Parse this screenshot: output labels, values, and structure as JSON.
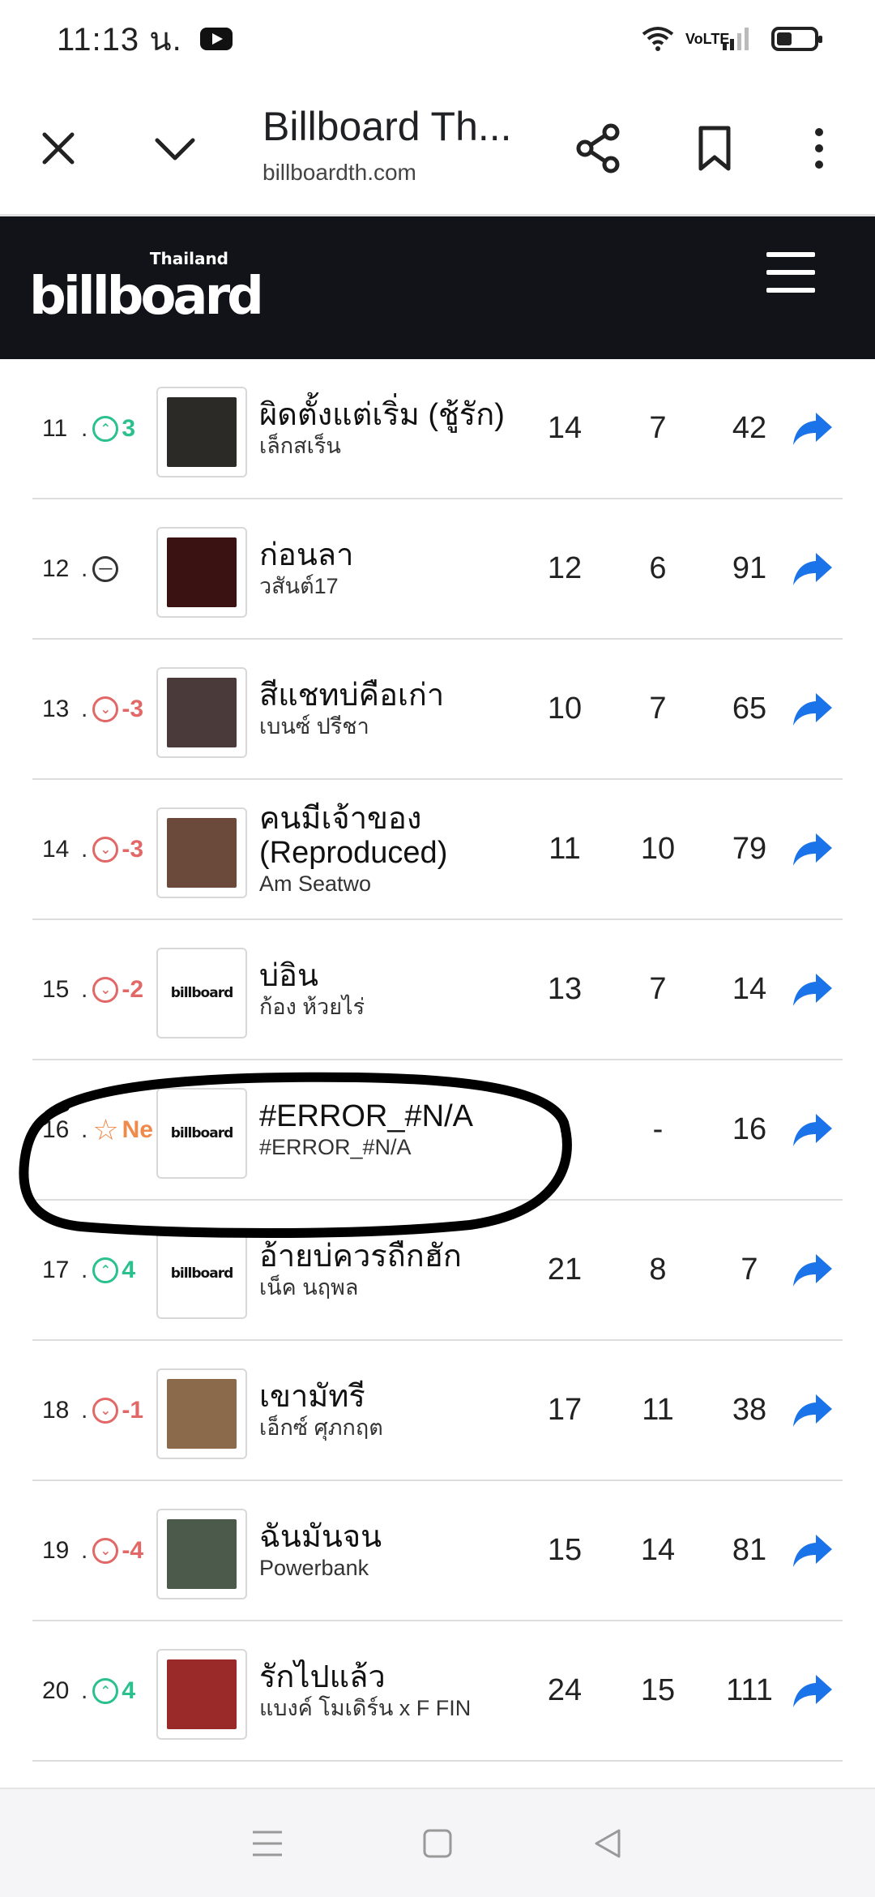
{
  "status_bar": {
    "time": "11:13 น.",
    "network": "VoLTE"
  },
  "browser": {
    "title": "Billboard Th...",
    "url": "billboardth.com"
  },
  "header": {
    "logo_main": "billboard",
    "logo_sub": "Thailand"
  },
  "chart": {
    "rows": [
      {
        "rank": "11",
        "trend": "up",
        "change": "3",
        "title": "ผิดตั้งแต่เริ่ม (ชู้รัก)",
        "artist": "เล็กสเร็น",
        "last_week": "14",
        "peak": "7",
        "weeks": "42",
        "cover": "photo",
        "cover_color": "#2b2a26"
      },
      {
        "rank": "12",
        "trend": "same",
        "change": "",
        "title": "ก่อนลา",
        "artist": "วสันต์17",
        "last_week": "12",
        "peak": "6",
        "weeks": "91",
        "cover": "photo",
        "cover_color": "#3a1212"
      },
      {
        "rank": "13",
        "trend": "down",
        "change": "-3",
        "title": "สีแชทบ่คือเก่า",
        "artist": "เบนซ์ ปรีชา",
        "last_week": "10",
        "peak": "7",
        "weeks": "65",
        "cover": "photo",
        "cover_color": "#4a3b3a"
      },
      {
        "rank": "14",
        "trend": "down",
        "change": "-3",
        "title": "คนมีเจ้าของ (Reproduced)",
        "artist": "Am Seatwo",
        "last_week": "11",
        "peak": "10",
        "weeks": "79",
        "cover": "photo",
        "cover_color": "#6b4a3b"
      },
      {
        "rank": "15",
        "trend": "down",
        "change": "-2",
        "title": "บ่อิน",
        "artist": "ก้อง ห้วยไร่",
        "last_week": "13",
        "peak": "7",
        "weeks": "14",
        "cover": "billboard",
        "cover_color": "#ffffff"
      },
      {
        "rank": "16",
        "trend": "new",
        "change": "Ne",
        "title": "#ERROR_#N/A",
        "artist": "#ERROR_#N/A",
        "last_week": "-",
        "peak": "-",
        "weeks": "16",
        "cover": "billboard",
        "cover_color": "#ffffff"
      },
      {
        "rank": "17",
        "trend": "up",
        "change": "4",
        "title": "อ้ายบ่ควรถืกฮัก",
        "artist": "เน็ค นฤพล",
        "last_week": "21",
        "peak": "8",
        "weeks": "7",
        "cover": "billboard",
        "cover_color": "#ffffff"
      },
      {
        "rank": "18",
        "trend": "down",
        "change": "-1",
        "title": "เขามัทรี",
        "artist": "เอ็กซ์ ศุภกฤต",
        "last_week": "17",
        "peak": "11",
        "weeks": "38",
        "cover": "photo",
        "cover_color": "#8a6a4b"
      },
      {
        "rank": "19",
        "trend": "down",
        "change": "-4",
        "title": "ฉันมันจน",
        "artist": "Powerbank",
        "last_week": "15",
        "peak": "14",
        "weeks": "81",
        "cover": "photo",
        "cover_color": "#4b5a4a"
      },
      {
        "rank": "20",
        "trend": "up",
        "change": "4",
        "title": "รักไปแล้ว",
        "artist": "แบงค์ โมเดิร์น x F FIN",
        "last_week": "24",
        "peak": "15",
        "weeks": "111",
        "cover": "photo",
        "cover_color": "#9a2a2a"
      }
    ]
  },
  "colors": {
    "up": "#2bc08f",
    "down": "#e26868",
    "new": "#f08a4b",
    "share": "#1a73e8",
    "header_bg": "#111318"
  }
}
